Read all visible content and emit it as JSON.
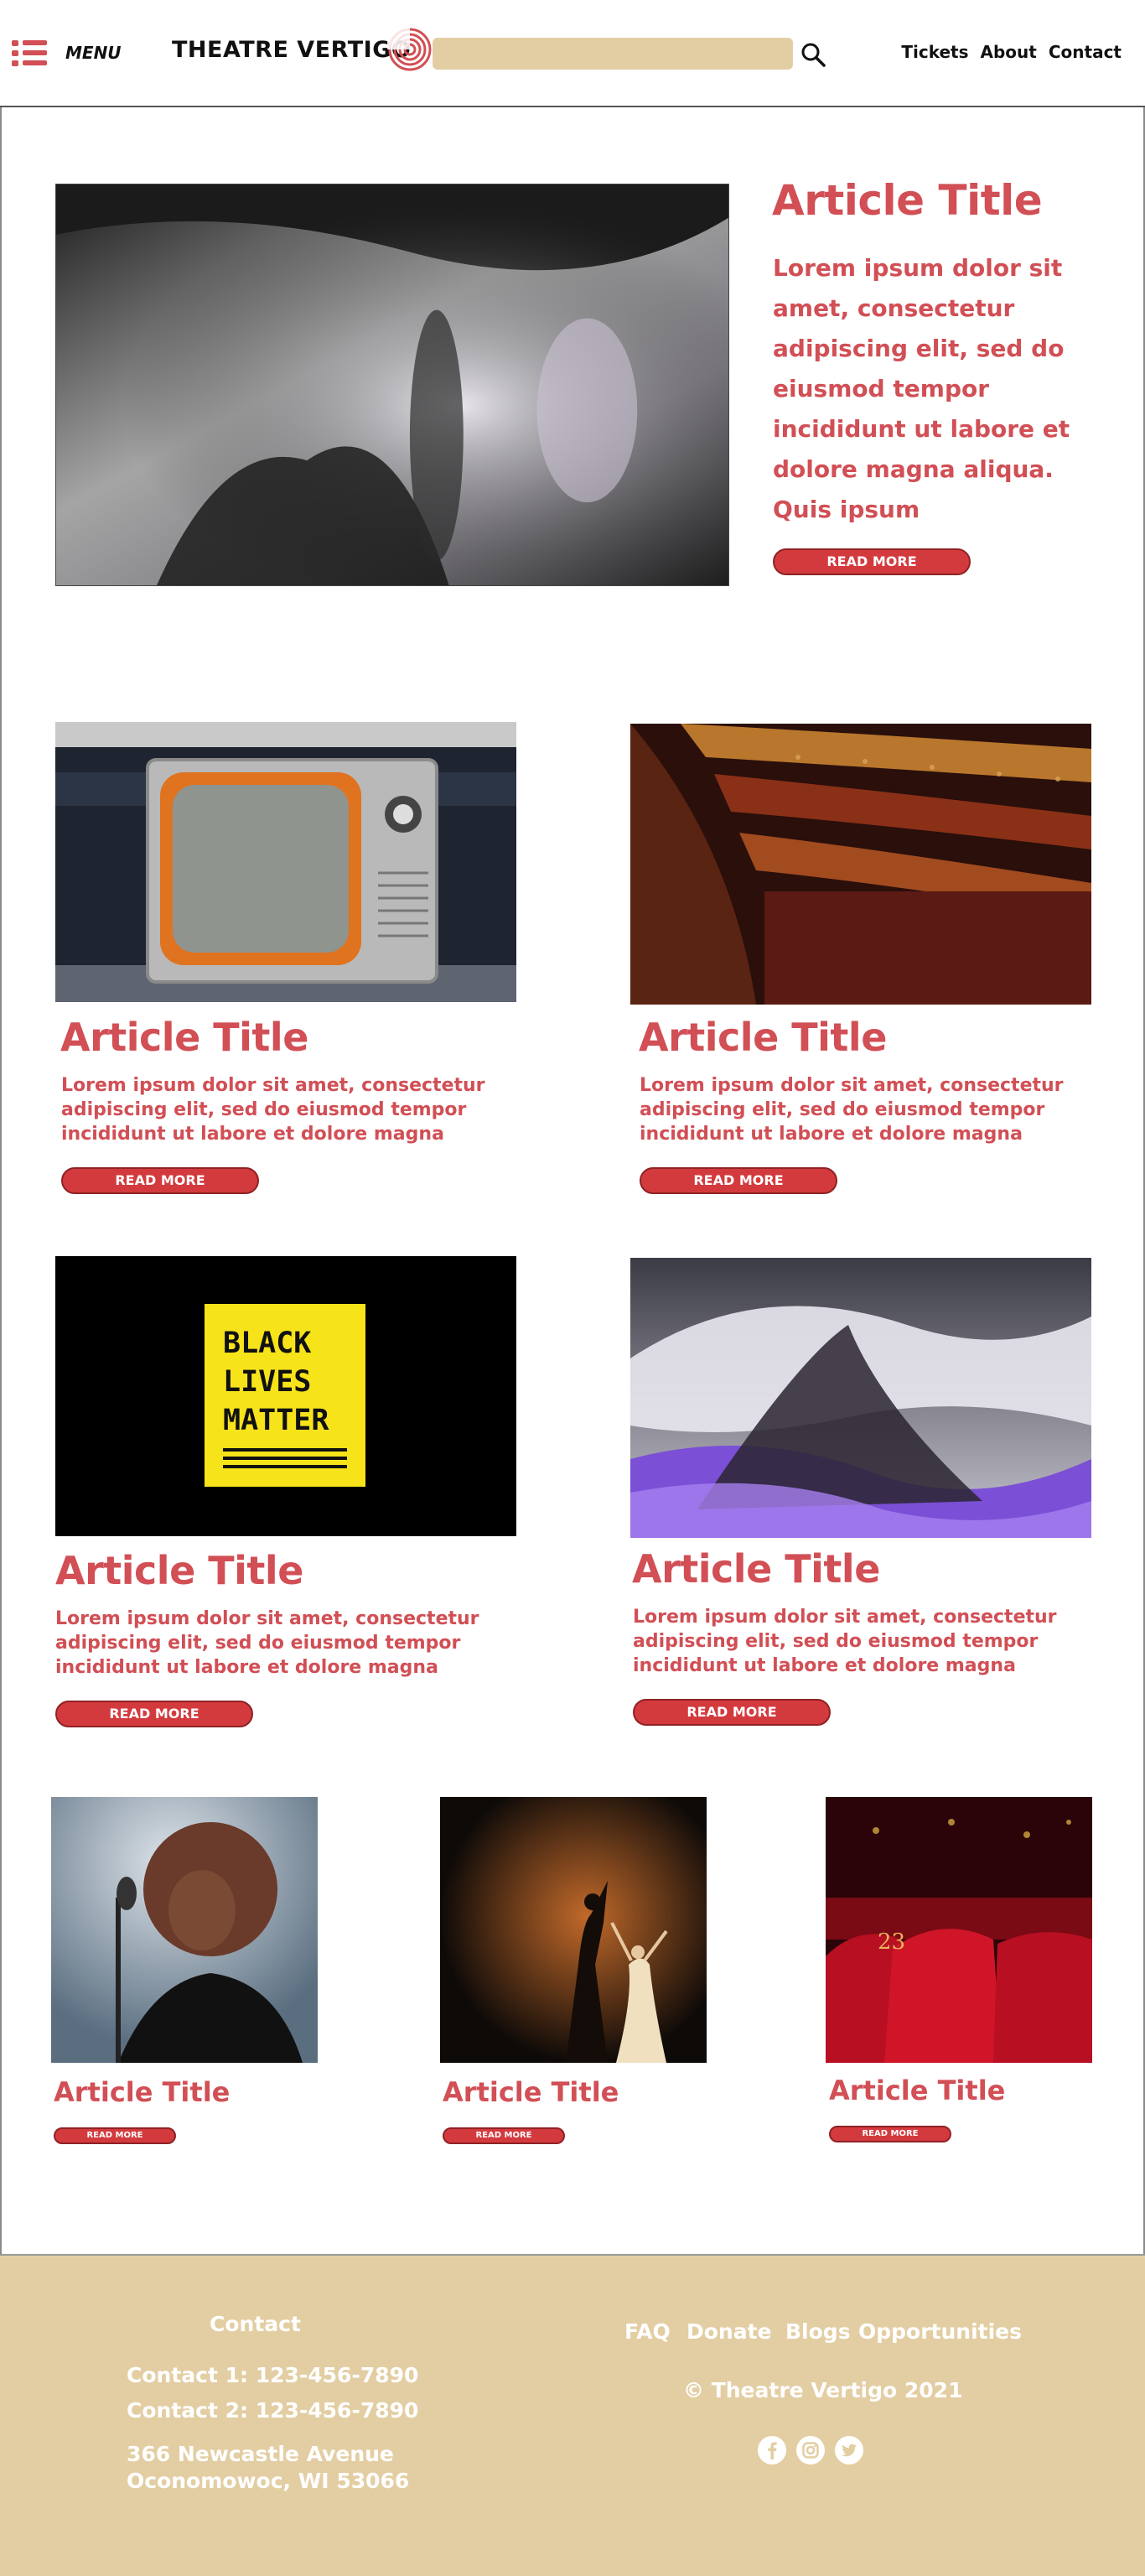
{
  "header": {
    "menu_label": "MENU",
    "logo_text": "THEATRE VERTIGO",
    "search_placeholder": "",
    "nav": [
      "Tickets",
      "About",
      "Contact"
    ],
    "colors": {
      "accent": "#d14f55",
      "search_bg": "#e3cea3"
    }
  },
  "feature": {
    "title": "Article Title",
    "body": "Lorem ipsum dolor sit amet, consectetur adipiscing elit, sed do eiusmod tempor incididunt ut labore et dolore magna aliqua. Quis ipsum",
    "button": "READ MORE"
  },
  "cards": [
    {
      "title": "Article Title",
      "body": "Lorem ipsum dolor sit amet, consectetur adipiscing elit, sed do eiusmod tempor incididunt ut labore et dolore magna",
      "button": "READ MORE"
    },
    {
      "title": "Article Title",
      "body": "Lorem ipsum dolor sit amet, consectetur adipiscing elit, sed do eiusmod tempor incididunt ut labore et dolore magna",
      "button": "READ MORE"
    },
    {
      "title": "Article Title",
      "body": "Lorem ipsum dolor sit amet, consectetur adipiscing elit, sed do eiusmod tempor incididunt ut labore et dolore magna",
      "button": "READ MORE",
      "image_text": [
        "BLACK",
        "LIVES",
        "MATTER"
      ]
    },
    {
      "title": "Article Title",
      "body": "Lorem ipsum dolor sit amet, consectetur adipiscing elit, sed do eiusmod tempor incididunt ut labore et dolore magna",
      "button": "READ MORE"
    }
  ],
  "small_cards": [
    {
      "title": "Article Title",
      "button": "READ MORE"
    },
    {
      "title": "Article Title",
      "button": "READ MORE"
    },
    {
      "title": "Article Title",
      "button": "READ MORE",
      "seat_number": "23"
    }
  ],
  "footer": {
    "contact_heading": "Contact",
    "contact_1": "Contact 1: 123-456-7890",
    "contact_2": "Contact 2: 123-456-7890",
    "address_1": "366 Newcastle Avenue",
    "address_2": "Oconomowoc, WI 53066",
    "links": [
      "FAQ",
      "Donate",
      "Blogs",
      "Opportunities"
    ],
    "copyright": "© Theatre Vertigo 2021",
    "social_icons": [
      "facebook-icon",
      "instagram-icon",
      "twitter-icon"
    ]
  }
}
